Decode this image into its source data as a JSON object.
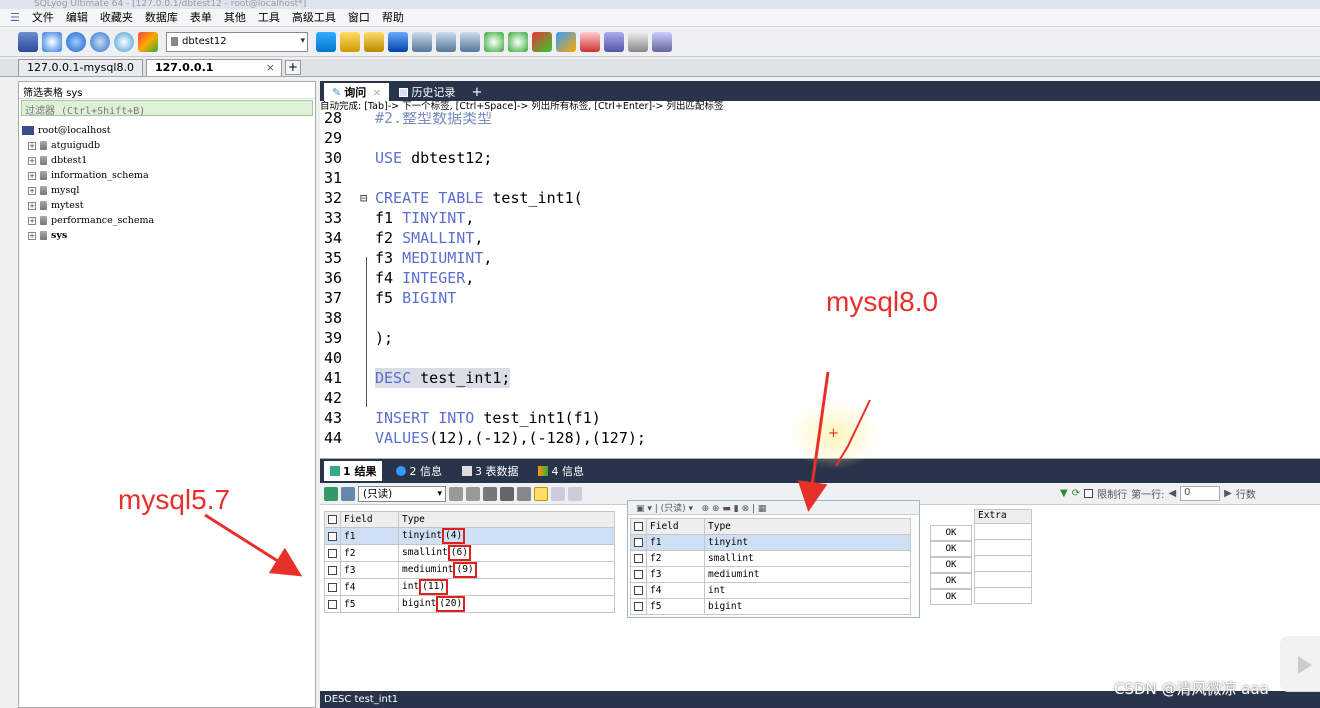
{
  "window": {
    "title": "SQLyog Ultimate 64 - [127.0.0.1/dbtest12 - root@localhost*]"
  },
  "menu": [
    "文件",
    "编辑",
    "收藏夹",
    "数据库",
    "表单",
    "其他",
    "工具",
    "高级工具",
    "窗口",
    "帮助"
  ],
  "toolbar": {
    "database_select": "dbtest12"
  },
  "connection_tabs": [
    {
      "label": "127.0.0.1-mysql8.0",
      "active": false
    },
    {
      "label": "127.0.0.1",
      "active": true
    }
  ],
  "left_panel": {
    "header": "筛选表格 sys",
    "filter_placeholder": "过滤器 (Ctrl+Shift+B)",
    "root": "root@localhost",
    "databases": [
      "atguigudb",
      "dbtest1",
      "information_schema",
      "mysql",
      "mytest",
      "performance_schema",
      "sys"
    ]
  },
  "query_tabs": [
    {
      "label": "询问",
      "active": true
    },
    {
      "label": "历史记录",
      "active": false
    }
  ],
  "hint": "自动完成: [Tab]-> 下一个标签, [Ctrl+Space]-> 列出所有标签, [Ctrl+Enter]-> 列出匹配标签",
  "editor_lines": [
    {
      "n": "28",
      "code": "#2.整型数据类型"
    },
    {
      "n": "29",
      "code": ""
    },
    {
      "n": "30",
      "code": "USE dbtest12;"
    },
    {
      "n": "31",
      "code": ""
    },
    {
      "n": "32",
      "code": "CREATE TABLE test_int1("
    },
    {
      "n": "33",
      "code": "f1 TINYINT,"
    },
    {
      "n": "34",
      "code": "f2 SMALLINT,"
    },
    {
      "n": "35",
      "code": "f3 MEDIUMINT,"
    },
    {
      "n": "36",
      "code": "f4 INTEGER,"
    },
    {
      "n": "37",
      "code": "f5 BIGINT"
    },
    {
      "n": "38",
      "code": ""
    },
    {
      "n": "39",
      "code": ");"
    },
    {
      "n": "40",
      "code": ""
    },
    {
      "n": "41",
      "code": "DESC test_int1;"
    },
    {
      "n": "42",
      "code": ""
    },
    {
      "n": "43",
      "code": "INSERT INTO test_int1(f1)"
    },
    {
      "n": "44",
      "code": "VALUES(12),(-12),(-128),(127);"
    }
  ],
  "result_tabs": [
    {
      "label": "1 结果",
      "active": true
    },
    {
      "label": "2 信息",
      "active": false
    },
    {
      "label": "3 表数据",
      "active": false
    },
    {
      "label": "4 信息",
      "active": false
    }
  ],
  "result_toolbar": {
    "mode": "(只读)",
    "limit_label": "限制行",
    "first_row_label": "第一行:",
    "first_row_value": "0",
    "rows_label": "行数"
  },
  "grid57": {
    "headers": [
      "Field",
      "Type"
    ],
    "rows": [
      {
        "field": "f1",
        "type": "tinyint",
        "width": "(4)"
      },
      {
        "field": "f2",
        "type": "smallint",
        "width": "(6)"
      },
      {
        "field": "f3",
        "type": "mediumint",
        "width": "(9)"
      },
      {
        "field": "f4",
        "type": "int",
        "width": "(11)"
      },
      {
        "field": "f5",
        "type": "bigint",
        "width": "(20)"
      }
    ]
  },
  "grid80": {
    "toolbar_text": "(只读)",
    "headers": [
      "Field",
      "Type"
    ],
    "rows": [
      {
        "field": "f1",
        "type": "tinyint"
      },
      {
        "field": "f2",
        "type": "smallint"
      },
      {
        "field": "f3",
        "type": "mediumint"
      },
      {
        "field": "f4",
        "type": "int"
      },
      {
        "field": "f5",
        "type": "bigint"
      }
    ]
  },
  "ok_cells": [
    "OK",
    "OK",
    "OK",
    "OK",
    "OK"
  ],
  "extra_header": "Extra",
  "status": "DESC test_int1",
  "annotations": {
    "mysql80": "mysql8.0",
    "mysql57": "mysql5.7"
  },
  "watermark": "CSDN @清风微凉 aaa",
  "colors": {
    "accent_dark": "#28344a",
    "annotation_red": "#e8302a",
    "keyword": "#5a6fd0"
  }
}
